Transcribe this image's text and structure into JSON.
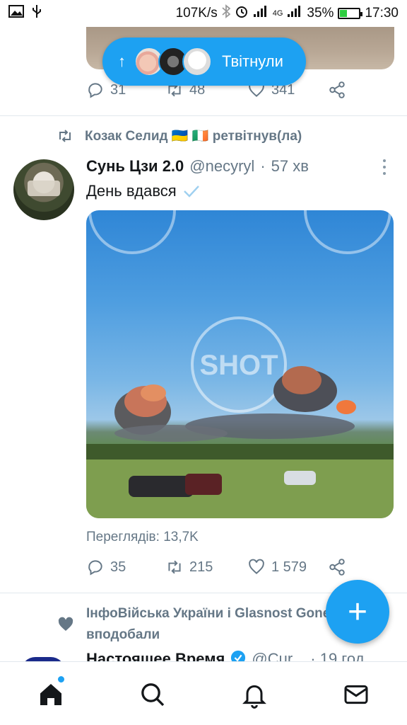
{
  "status_bar": {
    "speed": "107K/s",
    "network": "4G",
    "battery": "35%",
    "battery_level": 0.35,
    "time": "17:30",
    "icons": [
      "image-icon",
      "usb-icon",
      "bluetooth-icon",
      "alarm-icon",
      "signal-icon",
      "signal-4g-icon",
      "battery-icon"
    ]
  },
  "tweeted_pill": {
    "label": "Твітнули",
    "icon": "arrow-up-icon"
  },
  "prev_tweet": {
    "replies": "31",
    "retweets": "48",
    "likes": "341"
  },
  "tweet": {
    "retweeted_by": "Козак Селид 🇺🇦 🇮🇪 ретвітнув(ла)",
    "name": "Сунь Цзи 2.0",
    "handle": "@necyryl",
    "dot": "·",
    "time": "57 хв",
    "text": "День вдався",
    "media_watermark": "SHOT",
    "views": "Переглядів: 13,7K",
    "replies": "35",
    "retweets": "215",
    "likes": "1 579"
  },
  "liked_notice": {
    "line1": "ІнфоВійська України і Glasnost Gone",
    "line2": "вподобали"
  },
  "next_tweet": {
    "name": "Настоящее Время",
    "handle": "@Cur...",
    "time": "· 19 год"
  },
  "fab": {
    "label": "+"
  },
  "bottom_nav": [
    "home-icon",
    "search-icon",
    "notifications-icon",
    "messages-icon"
  ],
  "colors": {
    "accent": "#1da1f2",
    "muted": "#657786",
    "text": "#14171a",
    "divider": "#e1e8ed"
  }
}
